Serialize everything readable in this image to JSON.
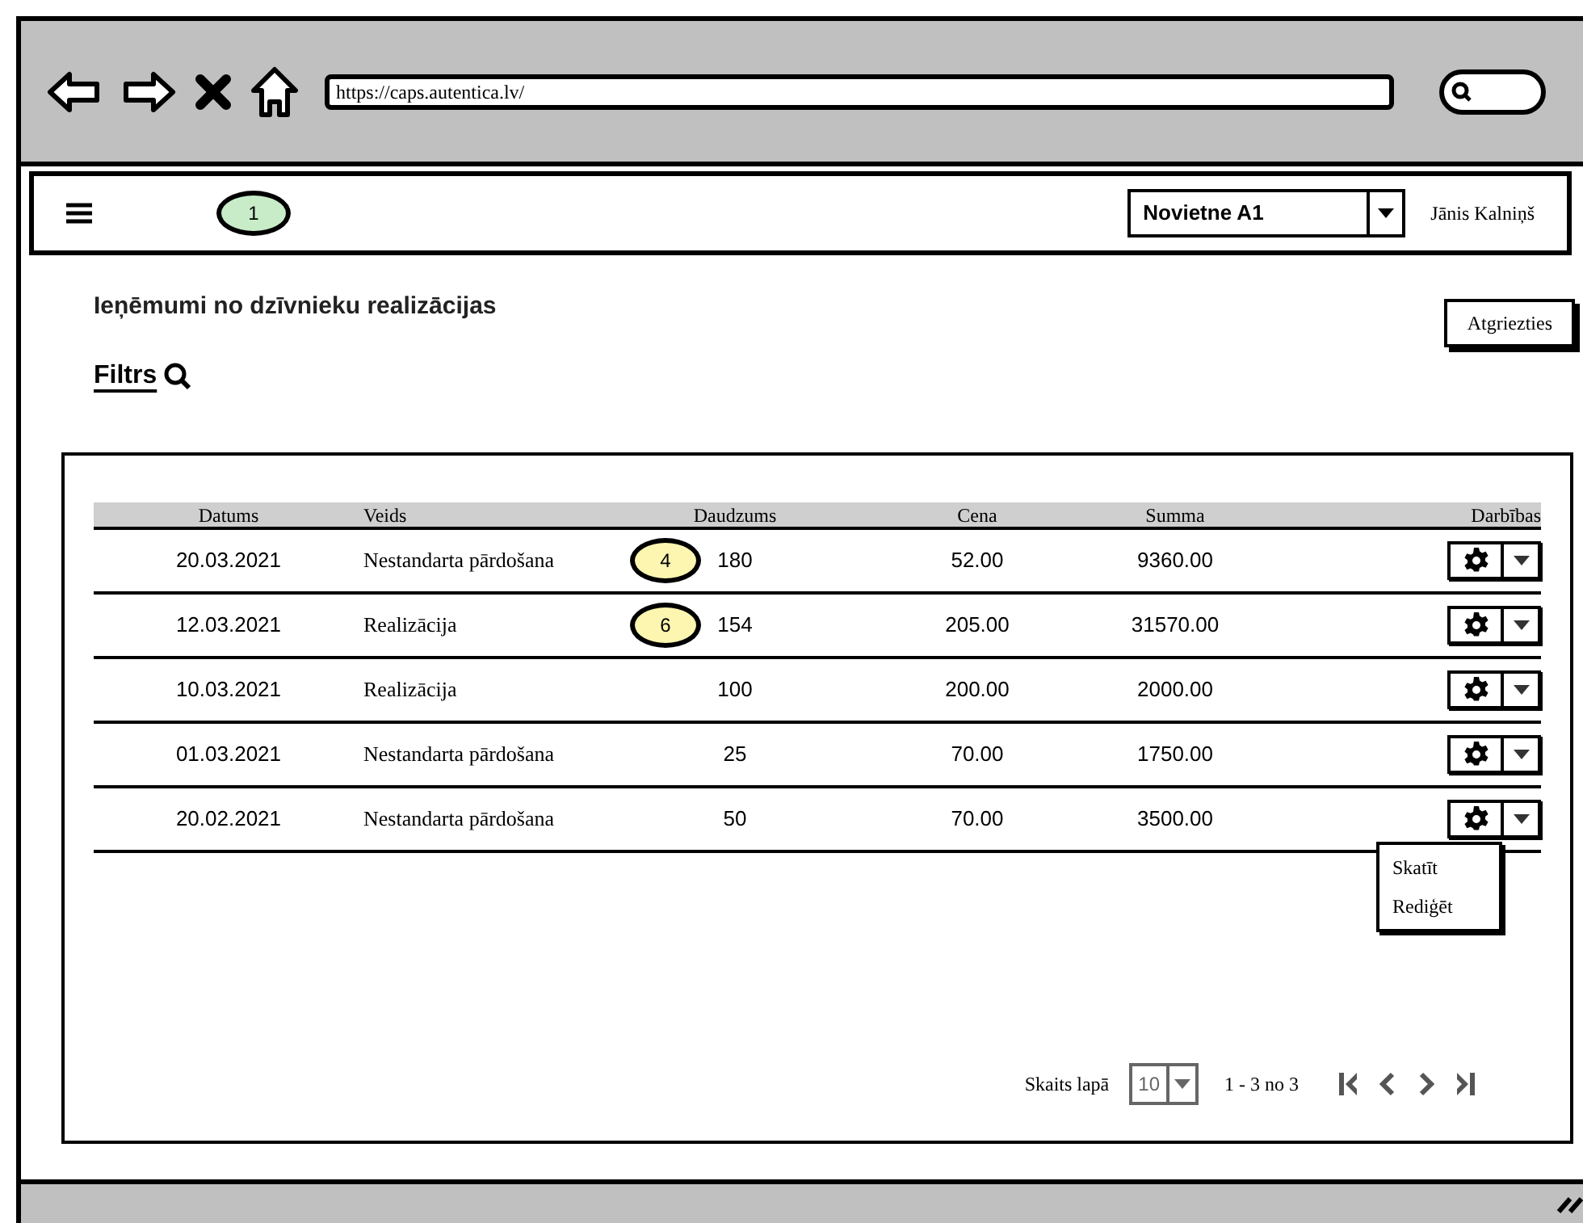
{
  "browser": {
    "url": "https://caps.autentica.lv/"
  },
  "navbar": {
    "annotation": {
      "label": "1",
      "color": "#c8ecc8"
    },
    "location_select": {
      "value": "Novietne A1"
    },
    "user": "Jānis Kalniņš"
  },
  "page": {
    "title": "Ieņēmumi no dzīvnieku realizācijas",
    "filter_link": "Filtrs",
    "back_button": "Atgriezties"
  },
  "table": {
    "columns": [
      "Datums",
      "Veids",
      "Daudzums",
      "Cena",
      "Summa",
      "Darbības"
    ],
    "rows": [
      {
        "datums": "20.03.2021",
        "veids": "Nestandarta pārdošana",
        "daudzums": "180",
        "cena": "52.00",
        "summa": "9360.00",
        "annotation": {
          "label": "4",
          "color": "#fdf6b0"
        }
      },
      {
        "datums": "12.03.2021",
        "veids": "Realizācija",
        "daudzums": "154",
        "cena": "205.00",
        "summa": "31570.00",
        "annotation": {
          "label": "6",
          "color": "#fdf6b0"
        }
      },
      {
        "datums": "10.03.2021",
        "veids": "Realizācija",
        "daudzums": "100",
        "cena": "200.00",
        "summa": "2000.00"
      },
      {
        "datums": "01.03.2021",
        "veids": "Nestandarta pārdošana",
        "daudzums": "25",
        "cena": "70.00",
        "summa": "1750.00"
      },
      {
        "datums": "20.02.2021",
        "veids": "Nestandarta pārdošana",
        "daudzums": "50",
        "cena": "70.00",
        "summa": "3500.00",
        "menu_open": true
      }
    ],
    "action_menu": [
      "Skatīt",
      "Rediģēt"
    ]
  },
  "pagination": {
    "page_size_label": "Skaits lapā",
    "page_size": "10",
    "range": "1 - 3 no 3"
  }
}
